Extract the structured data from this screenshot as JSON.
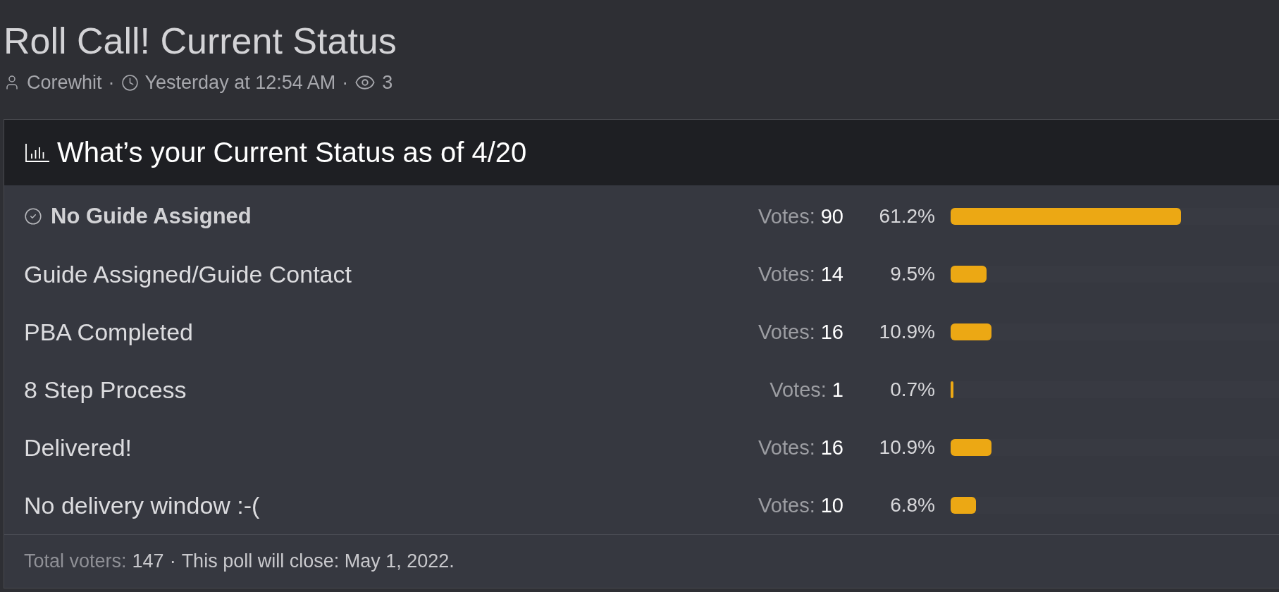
{
  "thread": {
    "title": "Roll Call! Current Status",
    "meta": [
      {
        "kind": "author",
        "text": "Corewhit"
      },
      {
        "kind": "separator",
        "text": "·"
      },
      {
        "kind": "time",
        "text": "Yesterday at 12:54 AM"
      },
      {
        "kind": "separator",
        "text": "·"
      },
      {
        "kind": "views",
        "text": "3"
      }
    ]
  },
  "poll": {
    "question": "What’s your Current Status as of 4/20",
    "options": [
      {
        "label": "No Guide Assigned",
        "selected": true,
        "votes_label": "Votes:",
        "votes": "90",
        "percent": "61.2%",
        "level": 0.612
      },
      {
        "label": "Guide Assigned/Guide Contact",
        "selected": false,
        "votes_label": "Votes:",
        "votes": "14",
        "percent": "9.5%",
        "level": 0.095
      },
      {
        "label": "PBA Completed",
        "selected": false,
        "votes_label": "Votes:",
        "votes": "16",
        "percent": "10.9%",
        "level": 0.109
      },
      {
        "label": "8 Step Process",
        "selected": false,
        "votes_label": "Votes:",
        "votes": "1",
        "percent": "0.7%",
        "level": 0.007
      },
      {
        "label": "Delivered!",
        "selected": false,
        "votes_label": "Votes:",
        "votes": "16",
        "percent": "10.9%",
        "level": 0.109
      },
      {
        "label": "No delivery window :-(",
        "selected": false,
        "votes_label": "Votes:",
        "votes": "10",
        "percent": "6.8%",
        "level": 0.068
      }
    ],
    "footer": [
      {
        "kind": "label",
        "text": "Total voters:"
      },
      {
        "kind": "value",
        "text": "147"
      },
      {
        "kind": "separator",
        "text": "·"
      },
      {
        "kind": "value",
        "text": "This poll will close: May 1, 2022."
      }
    ]
  }
}
